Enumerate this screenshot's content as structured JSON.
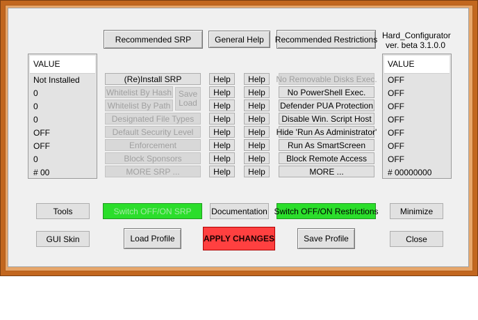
{
  "app": {
    "name": "Hard_Configurator",
    "version": "ver. beta 3.1.0.0"
  },
  "top_buttons": {
    "recommended_srp": "Recommended SRP",
    "general_help": "General Help",
    "recommended_restrictions": "Recommended Restrictions"
  },
  "left_list": {
    "header": "VALUE",
    "values": [
      "Not Installed",
      "0",
      "0",
      "0",
      "OFF",
      "OFF",
      "0",
      "# 00"
    ]
  },
  "srp_buttons": [
    "(Re)Install SRP",
    "Whitelist By Hash",
    "Whitelist By Path",
    "Designated File Types",
    "Default Security Level",
    "Enforcement",
    "Block Sponsors",
    "MORE SRP ..."
  ],
  "save_load": {
    "save": "Save",
    "load": "Load"
  },
  "help_label": "Help",
  "restriction_buttons": [
    "No Removable Disks Exec.",
    "No PowerShell Exec.",
    "Defender PUA Protection",
    "Disable Win. Script Host",
    "Hide  'Run As Administrator'",
    "Run As SmartScreen",
    "Block Remote Access",
    "MORE ..."
  ],
  "right_list": {
    "header": "VALUE",
    "values": [
      "OFF",
      "OFF",
      "OFF",
      "OFF",
      "OFF",
      "OFF",
      "OFF",
      "# 00000000"
    ]
  },
  "bottom": {
    "tools": "Tools",
    "switch_srp": "Switch OFF/ON SRP",
    "documentation": "Documentation",
    "switch_restrictions": "Switch OFF/ON Restrictions",
    "minimize": "Minimize",
    "gui_skin": "GUI Skin",
    "load_profile": "Load Profile",
    "apply_changes": "APPLY CHANGES",
    "save_profile": "Save Profile",
    "close": "Close"
  },
  "colors": {
    "frame": "#c2671f",
    "switch_green": "#2bde2b",
    "apply_red": "#ff4040"
  }
}
